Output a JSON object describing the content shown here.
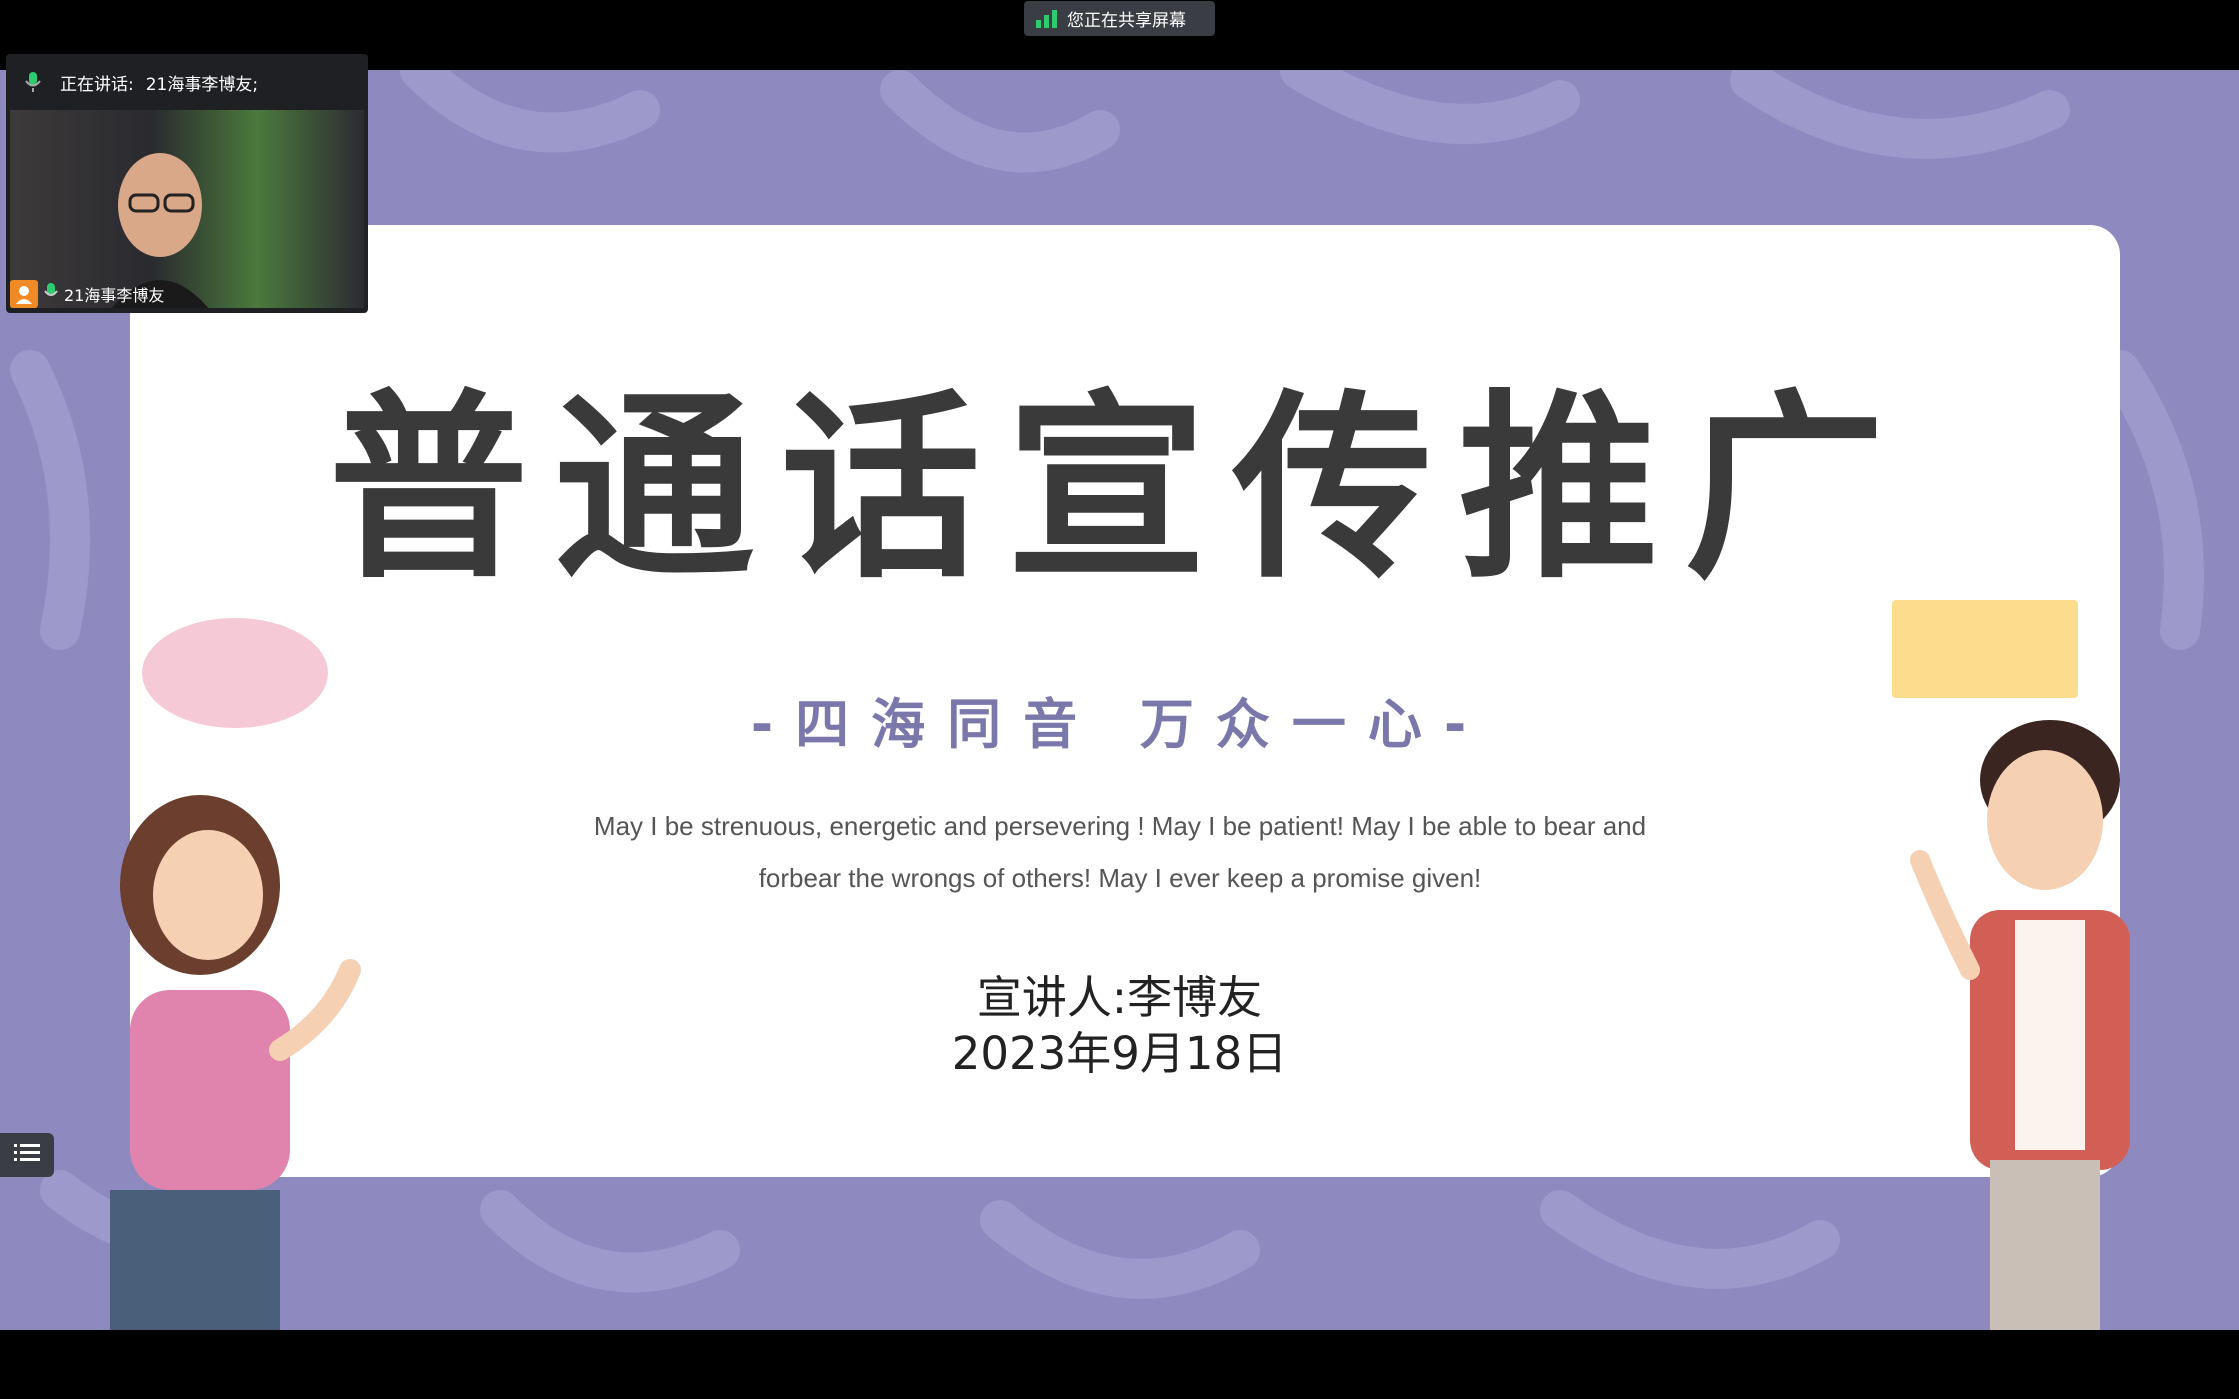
{
  "share_indicator": {
    "label": "您正在共享屏幕"
  },
  "video_tile": {
    "speaking_label": "正在讲话:",
    "speaking_name": "21海事李博友;",
    "participant_name": "21海事李博友"
  },
  "slide": {
    "title": "普通话宣传推广",
    "subtitle": "-四海同音 万众一心-",
    "quote_line1": "May I be strenuous, energetic and persevering ! May I be patient! May I be able to bear and",
    "quote_line2": "forbear the wrongs of others! May I ever keep a promise given!",
    "presenter": "宣讲人:李博友",
    "date": "2023年9月18日"
  },
  "colors": {
    "slide_bg": "#8e8ac0",
    "title": "#3a3a3a",
    "subtitle": "#7a78aa",
    "mic_green": "#2ecc71",
    "avatar_orange": "#f08a24"
  }
}
